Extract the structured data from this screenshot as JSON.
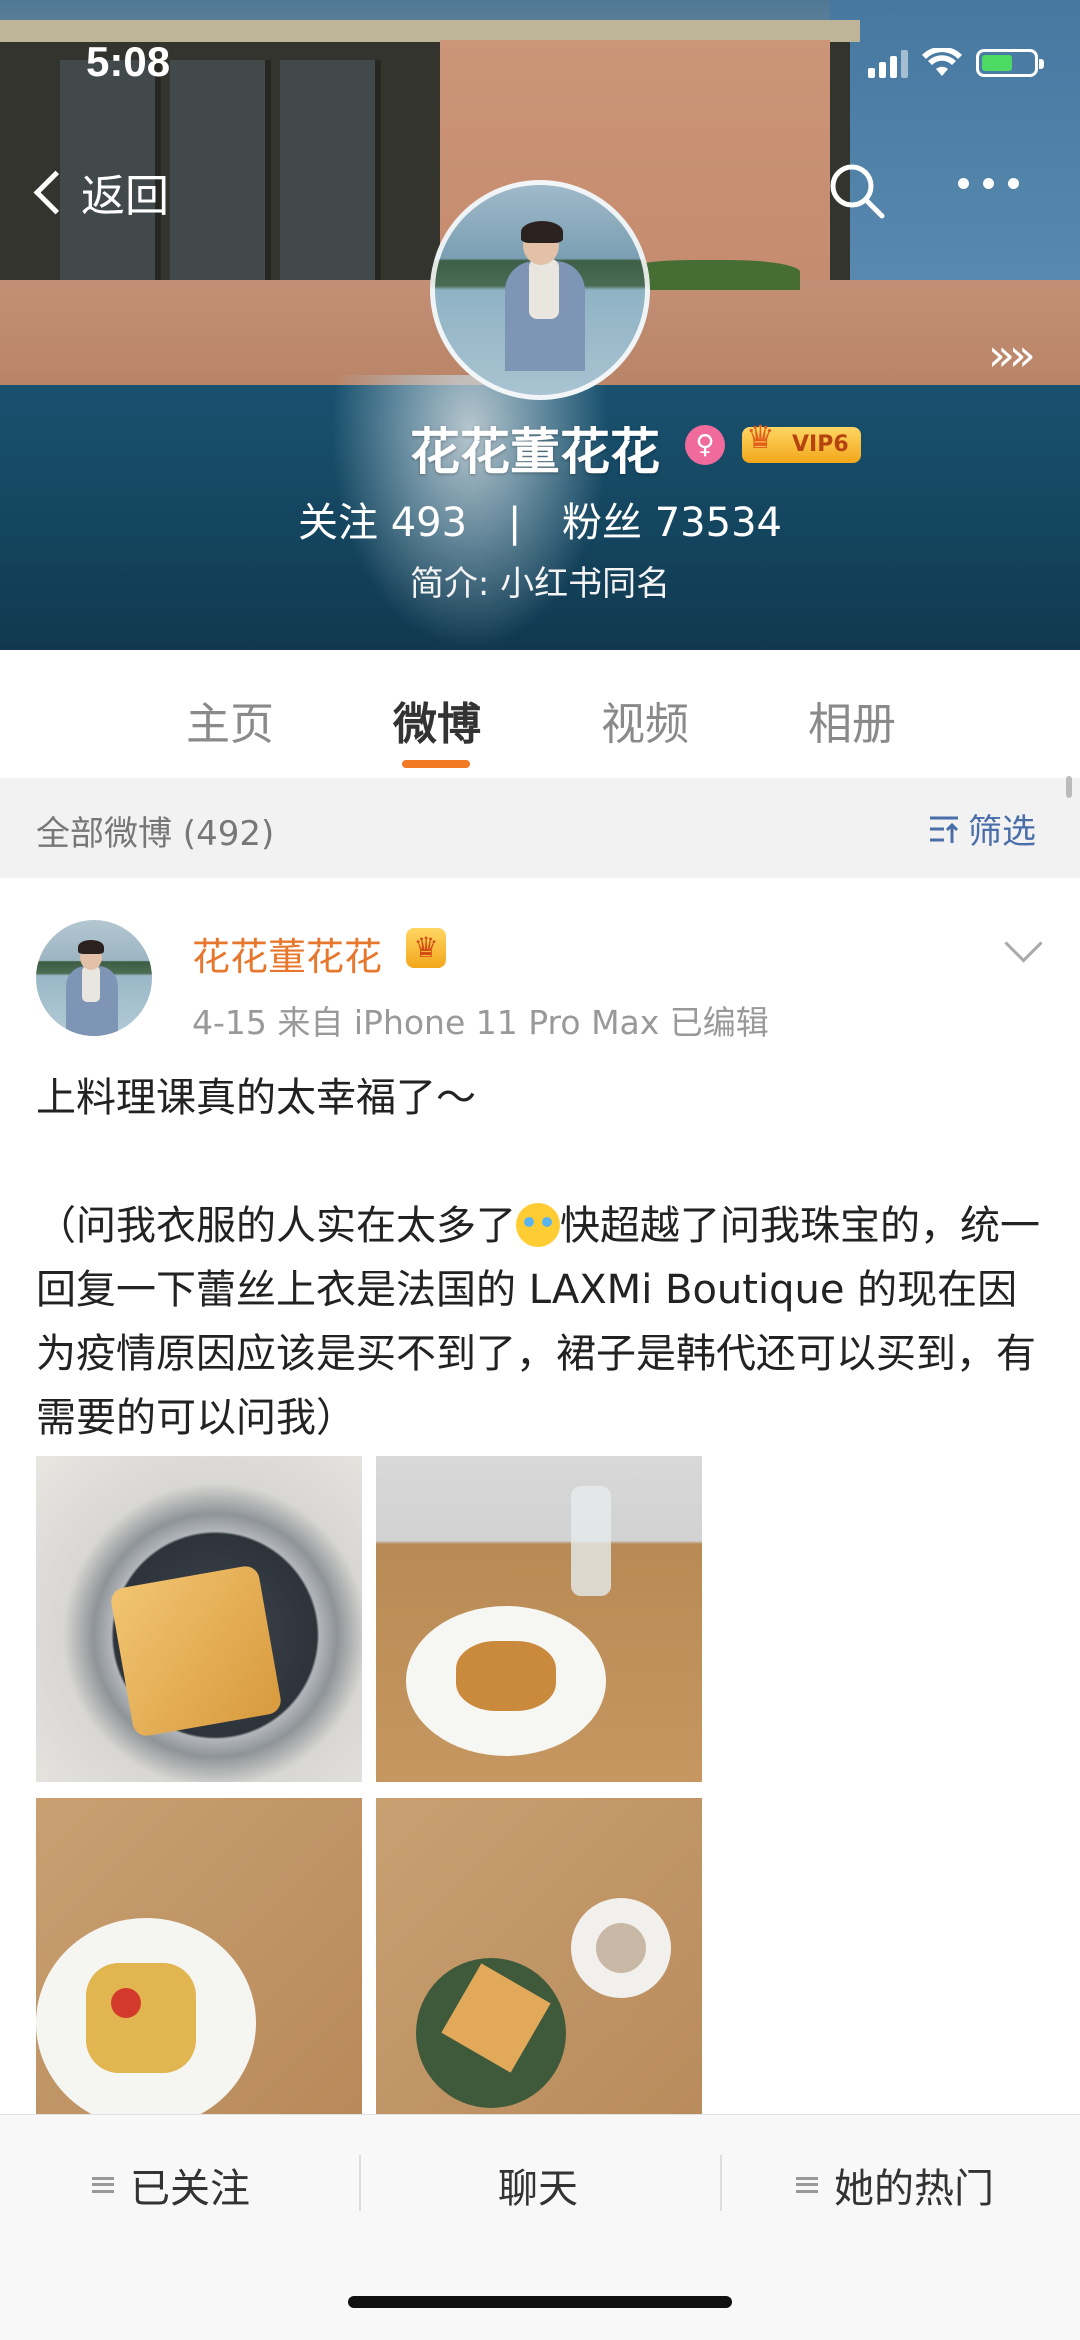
{
  "status_bar": {
    "time": "5:08"
  },
  "nav": {
    "back_label": "返回",
    "more_arrows": "»»"
  },
  "profile": {
    "name": "花花董花花",
    "gender_symbol": "♀",
    "vip_label": "VIP6",
    "following_label": "关注",
    "following_count": "493",
    "separator": "|",
    "followers_label": "粉丝",
    "followers_count": "73534",
    "intro": "简介: 小红书同名"
  },
  "tabs": [
    {
      "label": "主页"
    },
    {
      "label": "微博",
      "active": true
    },
    {
      "label": "视频"
    },
    {
      "label": "相册"
    }
  ],
  "filter": {
    "count_label": "全部微博 (492)",
    "filter_label": "筛选"
  },
  "post": {
    "author": "花花董花花",
    "meta": "4-15  来自 iPhone 11 Pro Max  已编辑",
    "line1": "上料理课真的太幸福了～",
    "line2a": "（问我衣服的人实在太多了",
    "line2b": "快超越了问我珠宝的，统一回复一下蕾丝上衣是法国的 LAXMi Boutique 的现在因为疫情原因应该是买不到了，裙子是韩代还可以买到，有需要的可以问我）",
    "emoji": "crying-laughing-emoji"
  },
  "bottom_bar": {
    "followed": "已关注",
    "chat": "聊天",
    "her_hot": "她的热门"
  },
  "colors": {
    "accent_orange": "#f37a25",
    "name_orange": "#e8772e",
    "filter_blue": "#4a6ea8",
    "female_pink": "#f06a9c"
  }
}
